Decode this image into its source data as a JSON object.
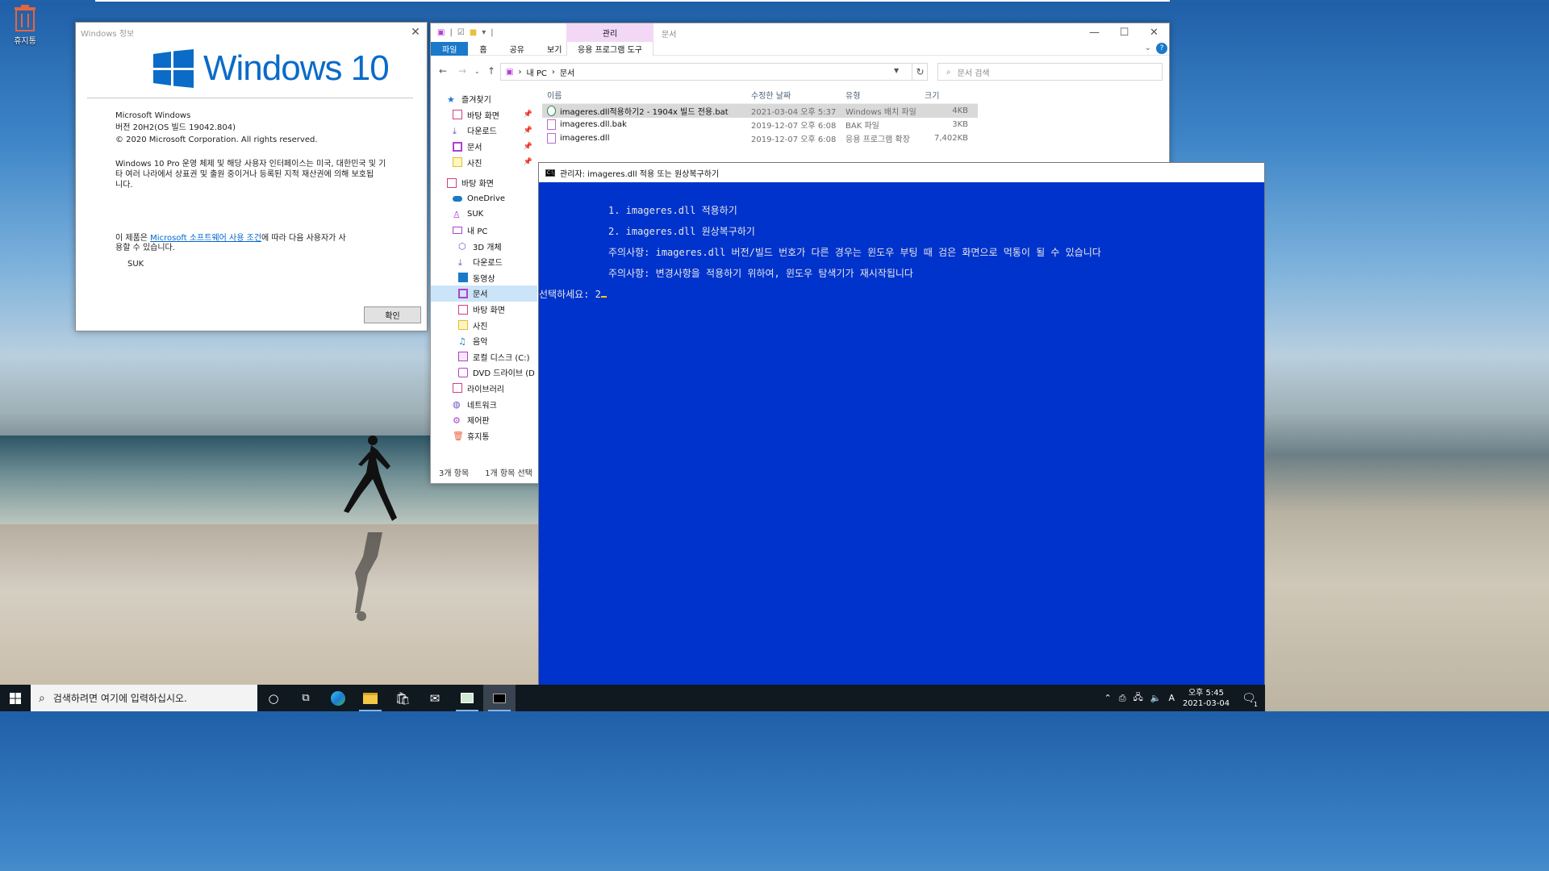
{
  "desktop": {
    "recycle_label": "휴지통"
  },
  "winver": {
    "title": "Windows 정보",
    "logo_text": "Windows 10",
    "product": "Microsoft Windows",
    "version": "버전 20H2(OS 빌드 19042.804)",
    "copyright": "© 2020 Microsoft Corporation. All rights reserved.",
    "desc_line1": "Windows 10 Pro 운영 체제 및 해당 사용자 인터페이스는 미국, 대한민국 및 기",
    "desc_line2": "타 여러 나라에서 상표권 및 출원 중이거나 등록된 지적 재산권에 의해 보호됩",
    "desc_line3": "니다.",
    "license_prefix": "이 제품은 ",
    "license_link": "Microsoft 소프트웨어 사용 조건",
    "license_suffix": "에 따라 다음 사용자가 사",
    "license_line2": "용할 수 있습니다.",
    "user": "SUK",
    "ok_label": "확인"
  },
  "explorer": {
    "manage_tab": "관리",
    "doc_title": "문서",
    "ribbon_tabs": [
      "파일",
      "홈",
      "공유",
      "보기"
    ],
    "app_tools_tab": "응용 프로그램 도구",
    "breadcrumb": [
      "내 PC",
      "문서"
    ],
    "search_placeholder": "문서 검색",
    "nav": {
      "quick_access": "즐겨찾기",
      "qa_desktop": "바탕 화면",
      "qa_downloads": "다운로드",
      "qa_documents": "문서",
      "qa_pictures": "사진",
      "desktop": "바탕 화면",
      "onedrive": "OneDrive",
      "user": "SUK",
      "thispc": "내 PC",
      "objects3d": "3D 개체",
      "downloads": "다운로드",
      "videos": "동영상",
      "documents": "문서",
      "pc_desktop": "바탕 화면",
      "pictures": "사진",
      "music": "음악",
      "local_disk": "로컬 디스크 (C:)",
      "dvd": "DVD 드라이브 (D",
      "libraries": "라이브러리",
      "network": "네트워크",
      "control_panel": "제어판",
      "recycle": "휴지통"
    },
    "columns": {
      "name": "이름",
      "date": "수정한 날짜",
      "type": "유형",
      "size": "크기"
    },
    "files": [
      {
        "name": "imageres.dll적용하기2 - 1904x 빌드 전용.bat",
        "date": "2021-03-04 오후 5:37",
        "type": "Windows 배치 파일",
        "size": "4KB"
      },
      {
        "name": "imageres.dll.bak",
        "date": "2019-12-07 오후 6:08",
        "type": "BAK 파일",
        "size": "3KB"
      },
      {
        "name": "imageres.dll",
        "date": "2019-12-07 오후 6:08",
        "type": "응용 프로그램 확장",
        "size": "7,402KB"
      }
    ],
    "status_count": "3개 항목",
    "status_selected": "1개 항목 선택"
  },
  "console": {
    "title": "관리자:  imageres.dll 적용 또는 원상복구하기",
    "line1": "1. imageres.dll 적용하기",
    "line2": "2. imageres.dll 원상복구하기",
    "line3": "주의사항: imageres.dll 버전/빌드 번호가 다른 경우는 윈도우 부팅 때 검은 화면으로 먹통이 될 수 있습니다",
    "line4": "주의사항: 변경사항을 적용하기 위하여, 윈도우 탐색기가 재시작됩니다",
    "prompt": "선택하세요: 2"
  },
  "taskbar": {
    "search_placeholder": "검색하려면 여기에 입력하십시오.",
    "ime": "A",
    "time": "오후 5:45",
    "date": "2021-03-04",
    "notif_count": "1"
  }
}
